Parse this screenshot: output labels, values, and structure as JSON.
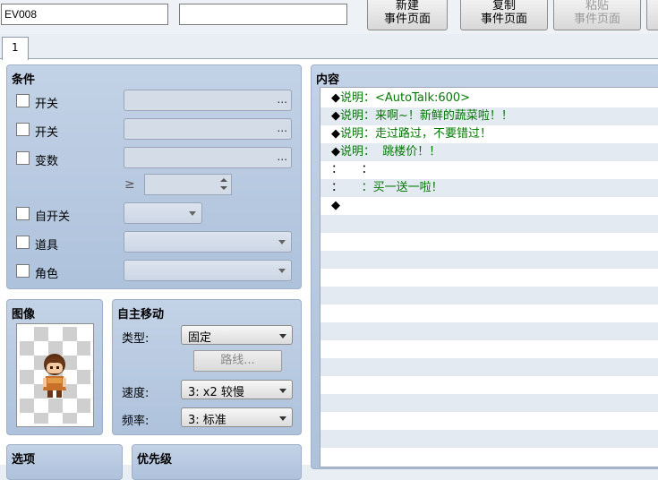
{
  "top": {
    "event_name": "EV008",
    "note": "",
    "buttons": [
      {
        "line1": "新建",
        "line2": "事件页面",
        "enabled": true
      },
      {
        "line1": "复制",
        "line2": "事件页面",
        "enabled": true
      },
      {
        "line1": "粘贴",
        "line2": "事件页面",
        "enabled": false
      }
    ]
  },
  "tabs": [
    "1"
  ],
  "conditions": {
    "title": "条件",
    "switch1": "开关",
    "switch2": "开关",
    "variable": "变数",
    "compare_symbol": "≥",
    "self_switch": "自开关",
    "item": "道具",
    "actor": "角色",
    "dots": "..."
  },
  "image": {
    "title": "图像"
  },
  "autonomous": {
    "title": "自主移动",
    "type_label": "类型:",
    "type_value": "固定",
    "route_button": "路线...",
    "speed_label": "速度:",
    "speed_value": "3: x2 较慢",
    "freq_label": "频率:",
    "freq_value": "3: 标准"
  },
  "options": {
    "title": "选项"
  },
  "priority": {
    "title": "优先级"
  },
  "content": {
    "title": "内容",
    "lines": [
      {
        "mark": "◆",
        "text": "说明：<AutoTalk:600>"
      },
      {
        "mark": "◆",
        "text": "说明：来啊~！新鲜的蔬菜啦！！"
      },
      {
        "mark": "◆",
        "text": "说明：走过路过，不要错过！"
      },
      {
        "mark": "◆",
        "text": "说明：  跳楼价！！"
      },
      {
        "mark": "：",
        "text": "     ："
      },
      {
        "mark": "：",
        "text": "     ：买一送一啦！"
      },
      {
        "mark": "◆",
        "text": ""
      }
    ]
  },
  "colors": {
    "panel": "#aec2dc",
    "command_text": "#007a00"
  }
}
